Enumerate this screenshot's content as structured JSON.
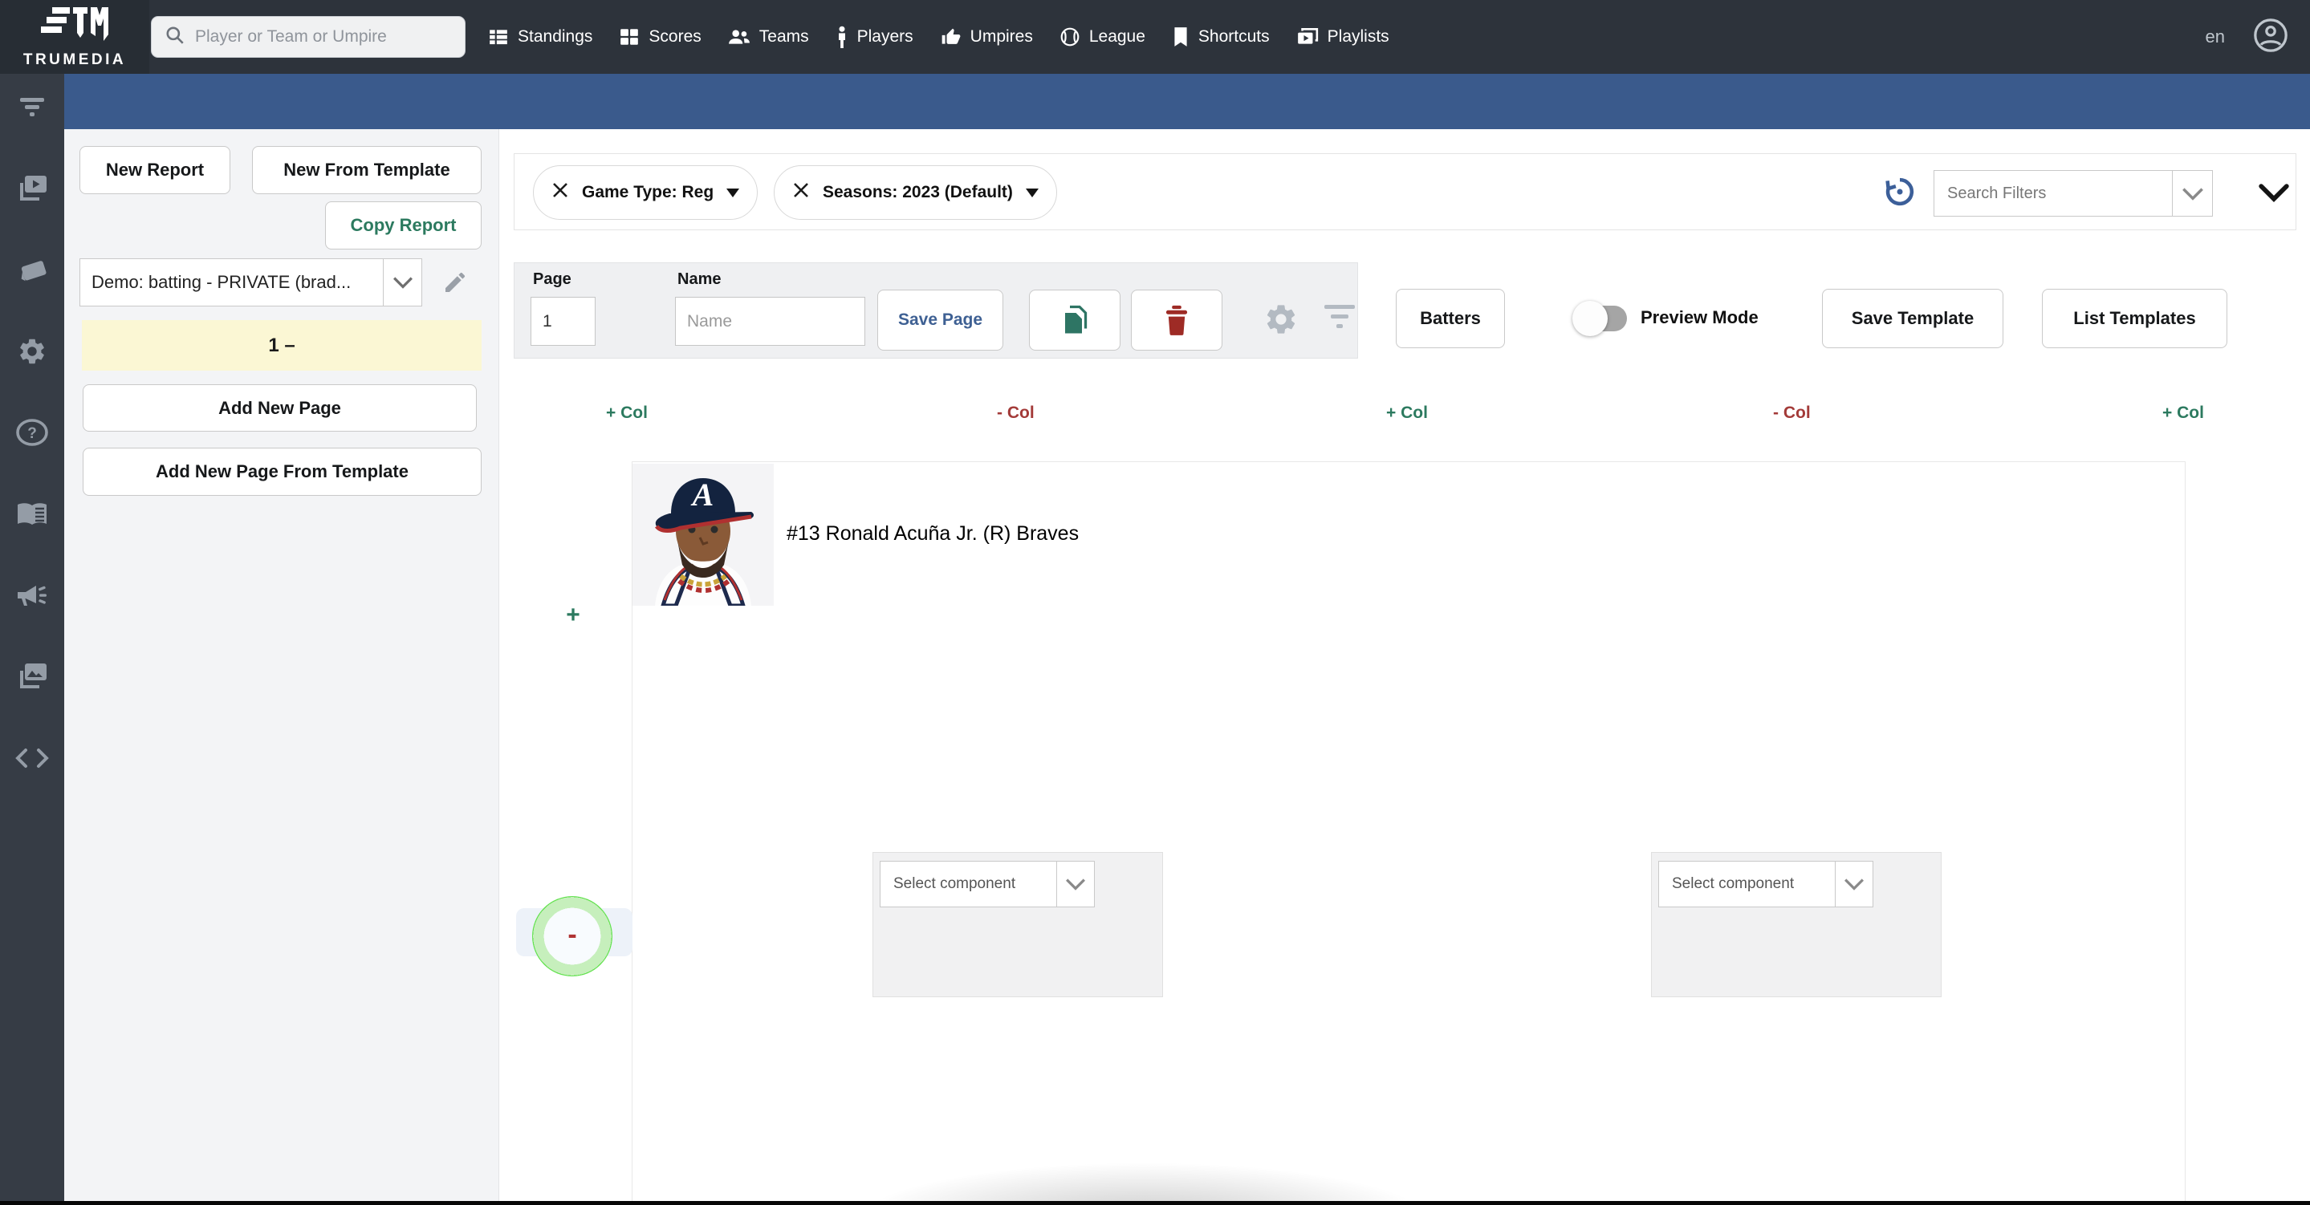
{
  "navbar": {
    "brand": "TRUMEDIA",
    "search_placeholder": "Player or Team or Umpire",
    "items": [
      {
        "label": "Standings",
        "icon": "standings-icon"
      },
      {
        "label": "Scores",
        "icon": "scores-icon"
      },
      {
        "label": "Teams",
        "icon": "teams-icon"
      },
      {
        "label": "Players",
        "icon": "players-icon"
      },
      {
        "label": "Umpires",
        "icon": "umpires-icon"
      },
      {
        "label": "League",
        "icon": "league-icon"
      },
      {
        "label": "Shortcuts",
        "icon": "shortcuts-icon"
      },
      {
        "label": "Playlists",
        "icon": "playlists-icon"
      }
    ],
    "locale": "en"
  },
  "side_rail": {
    "icons": [
      "filter-icon",
      "video-playlist-icon",
      "flashcards-icon",
      "settings-icon",
      "help-icon",
      "glossary-icon",
      "announcements-icon",
      "media-gallery-icon",
      "embed-code-icon"
    ]
  },
  "report_panel": {
    "new_report": "New Report",
    "new_from_template": "New From Template",
    "copy_report": "Copy Report",
    "report_name": "Demo: batting - PRIVATE (brad...",
    "page_item": "1 –",
    "add_new_page": "Add New Page",
    "add_new_page_from_template": "Add New Page From Template"
  },
  "filter_bar": {
    "chips": [
      {
        "label": "Game Type: Reg"
      },
      {
        "label": "Seasons: 2023 (Default)"
      }
    ],
    "search_filters_placeholder": "Search Filters"
  },
  "page_bar": {
    "page_label": "Page",
    "page_value": "1",
    "name_label": "Name",
    "name_placeholder": "Name",
    "save_page": "Save Page"
  },
  "template_bar": {
    "batters": "Batters",
    "preview_mode": "Preview Mode",
    "save_template": "Save Template",
    "list_templates": "List Templates"
  },
  "column_controls": [
    {
      "label": "+ Col"
    },
    {
      "label": "- Col"
    },
    {
      "label": "+ Col"
    },
    {
      "label": "- Col"
    },
    {
      "label": "+ Col"
    }
  ],
  "canvas": {
    "player_header": "#13 Ronald Acuña Jr. (R) Braves",
    "add_row_label": "+",
    "remove_row_label": "-",
    "select_component_placeholder": "Select component"
  },
  "colors": {
    "navbar_bg": "#2d333b",
    "blue_bar": "#3a5a8c",
    "accent_green": "#2c7a5f",
    "accent_red": "#a33a38",
    "link_blue": "#3e6093",
    "highlight_yellow": "#fbf7d4",
    "click_ring_green": "#63e24f"
  }
}
